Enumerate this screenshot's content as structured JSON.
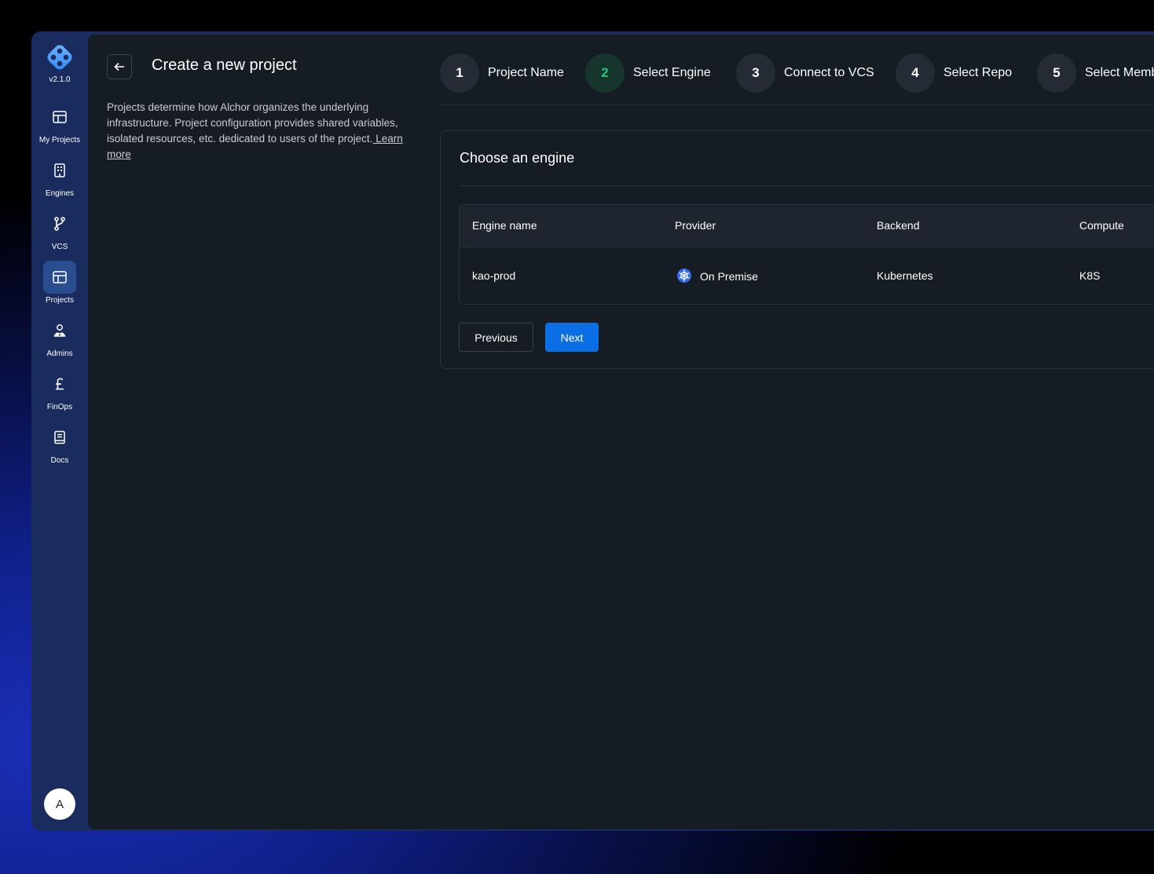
{
  "app": {
    "version": "v2.1.0",
    "avatar_initial": "A"
  },
  "sidebar": {
    "items": [
      {
        "label": "My Projects",
        "icon": "layout-icon",
        "active": false
      },
      {
        "label": "Engines",
        "icon": "building-icon",
        "active": false
      },
      {
        "label": "VCS",
        "icon": "git-branch-icon",
        "active": false
      },
      {
        "label": "Projects",
        "icon": "layout-icon",
        "active": true
      },
      {
        "label": "Admins",
        "icon": "user-group-icon",
        "active": false
      },
      {
        "label": "FinOps",
        "icon": "pound-icon",
        "active": false
      },
      {
        "label": "Docs",
        "icon": "book-icon",
        "active": false
      }
    ]
  },
  "header": {
    "title": "Create a new project",
    "description": "Projects determine how Alchor organizes the underlying infrastructure.  Project configuration provides shared variables, isolated resources,  etc. dedicated to users of the project.",
    "learn_more": " Learn more"
  },
  "stepper": {
    "steps": [
      {
        "number": "1",
        "label": "Project Name",
        "active": false
      },
      {
        "number": "2",
        "label": "Select Engine",
        "active": true
      },
      {
        "number": "3",
        "label": "Connect to VCS",
        "active": false
      },
      {
        "number": "4",
        "label": "Select Repo",
        "active": false
      },
      {
        "number": "5",
        "label": "Select Members",
        "active": false
      }
    ]
  },
  "engine_card": {
    "title": "Choose an engine",
    "columns": [
      "Engine name",
      "Provider",
      "Backend",
      "Compute"
    ],
    "rows": [
      {
        "engine_name": "kao-prod",
        "provider": "On Premise",
        "provider_icon": "kubernetes-icon",
        "backend": "Kubernetes",
        "compute": "K8S"
      }
    ],
    "previous_label": "Previous",
    "next_label": "Next"
  },
  "colors": {
    "accent": "#0a6ee4",
    "active_step": "#22c47a",
    "sidebar": "#1a2b5e",
    "panel": "#161c24"
  }
}
